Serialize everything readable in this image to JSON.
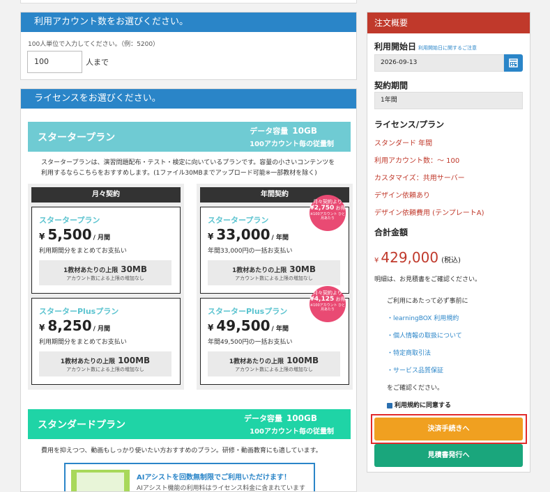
{
  "account": {
    "title": "利用アカウント数をお選びください。",
    "hint": "100人単位で入力してください。（例：5200）",
    "value": "100",
    "unit": "人まで"
  },
  "license": {
    "title": "ライセンスをお選びください。",
    "starter": {
      "name": "スタータープラン",
      "capacity_label": "データ容量",
      "capacity": "10GB",
      "cap_note": "100アカウント毎の従量制",
      "desc1": "スタータープランは、演習問題配布・テスト・検定に向いているプランです。容量の小さいコンテンツを",
      "desc2": "利用するならこちらをおすすめします。(1ファイル30MBまでアップロード可能※一部教材を除く)",
      "monthly_head": "月々契約",
      "yearly_head": "年間契約",
      "cards": [
        {
          "title": "スタータープラン",
          "yen": "¥",
          "price": "5,500",
          "per": "/ 月間",
          "note": "利用期間分をまとめてお支払い",
          "limit_label": "1教材あたりの上限",
          "limit": "30MB",
          "limit_note": "アカウント数による上限の増加なし"
        },
        {
          "title": "スタータープラン",
          "yen": "¥",
          "price": "33,000",
          "per": "/ 年間",
          "note": "年間33,000円の一括お支払い",
          "limit_label": "1教材あたりの上限",
          "limit": "30MB",
          "limit_note": "アカウント数による上限の増加なし"
        },
        {
          "title": "スターターPlusプラン",
          "yen": "¥",
          "price": "8,250",
          "per": "/ 月間",
          "note": "利用期間分をまとめてお支払い",
          "limit_label": "1教材あたりの上限",
          "limit": "100MB",
          "limit_note": "アカウント数による上限の増加なし"
        },
        {
          "title": "スターターPlusプラン",
          "yen": "¥",
          "price": "49,500",
          "per": "/ 年間",
          "note": "年間49,500円の一括お支払い",
          "limit_label": "1教材あたりの上限",
          "limit": "100MB",
          "limit_note": "アカウント数による上限の増加なし"
        }
      ],
      "badges": [
        {
          "l1": "月々契約より",
          "amount": "¥2,750",
          "suffix": "お得",
          "tiny": "※100アカウント ひと月あたり"
        },
        {
          "l1": "月々契約より",
          "amount": "¥4,125",
          "suffix": "お得",
          "tiny": "※100アカウント ひと月あたり"
        }
      ]
    },
    "standard": {
      "name": "スタンダードプラン",
      "capacity_label": "データ容量",
      "capacity": "100GB",
      "cap_note": "100アカウント毎の従量制",
      "desc": "費用を抑えつつ、動画もしっかり使いたい方おすすめのプラン。研修・動画教育にも適しています。"
    },
    "ai": {
      "title": "AIアシストを回数無制限でご利用いただけます！",
      "desc": "AIアシスト機能の利用料はライセンス料金に含まれています"
    }
  },
  "order": {
    "title": "注文概要",
    "start_label": "利用開始日",
    "start_link": "利用開始日に関するご注意",
    "start_date": "2026-09-13",
    "period_label": "契約期間",
    "period": "1年間",
    "plan_label": "ライセンス/プラン",
    "plan_lines": [
      "スタンダード 年間",
      "利用アカウント数：～ 100",
      "カスタマイズ：共用サーバー",
      "デザイン依頼あり",
      "デザイン依頼費用 (テンプレートA)"
    ],
    "total_label": "合計金額",
    "total_yen": "¥",
    "total": "429,000",
    "total_tax": "(税込)",
    "estimate_note": "明細は、お見積書をご確認ください。",
    "terms_intro": "ご利用にあたって必ず事前に",
    "terms_links": [
      "・learningBOX 利用規約",
      "・個人情報の取扱について",
      "・特定商取引法",
      "・サービス品質保証"
    ],
    "terms_outro": "をご確認ください。",
    "agree": "利用規約に同意する",
    "pay_button": "決済手続きへ",
    "quote_button": "見積書発行へ"
  },
  "colors": {
    "blue": "#2a85c8",
    "teal": "#6fcbd3",
    "green": "#1fd4a6",
    "red": "#c0392b",
    "orange": "#f0a020"
  }
}
